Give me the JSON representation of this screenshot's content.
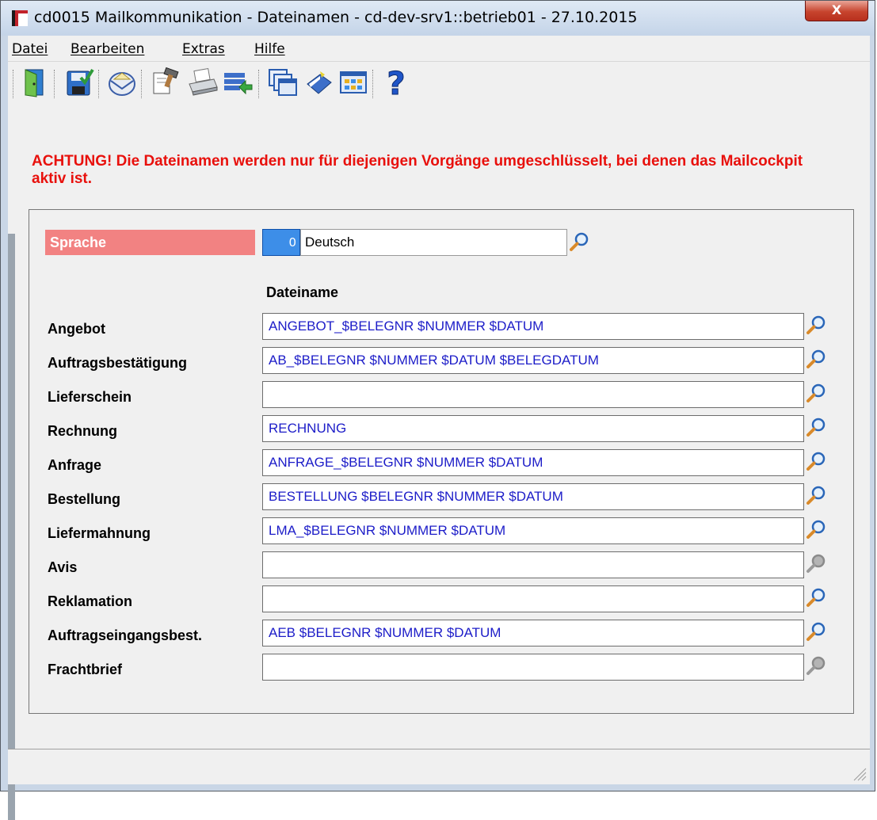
{
  "window": {
    "title": "cd0015 Mailkommunikation - Dateinamen - cd-dev-srv1::betrieb01 - 27.10.2015",
    "close_label": "X"
  },
  "menu": [
    "Datei",
    "Bearbeiten",
    "Extras",
    "Hilfe"
  ],
  "toolbar": {
    "buttons": [
      "exit-door-icon",
      "save-icon",
      "mail-icon",
      "edit-document-icon",
      "print-icon",
      "import-list-icon",
      "windows-icon",
      "book-icon",
      "grid-icon",
      "help-icon"
    ]
  },
  "warning": "ACHTUNG! Die Dateinamen werden nur für diejenigen Vorgänge umgeschlüsselt, bei denen das Mailcockpit aktiv ist.",
  "language": {
    "label": "Sprache",
    "code": "0",
    "name": "Deutsch"
  },
  "table": {
    "column_header": "Dateiname",
    "rows": [
      {
        "label": "Angebot",
        "value": "ANGEBOT_$BELEGNR $NUMMER $DATUM",
        "lookup_enabled": true
      },
      {
        "label": "Auftragsbestätigung",
        "value": "AB_$BELEGNR $NUMMER $DATUM $BELEGDATUM",
        "lookup_enabled": true
      },
      {
        "label": "Lieferschein",
        "value": "",
        "lookup_enabled": true
      },
      {
        "label": "Rechnung",
        "value": "RECHNUNG",
        "lookup_enabled": true
      },
      {
        "label": "Anfrage",
        "value": "ANFRAGE_$BELEGNR $NUMMER $DATUM",
        "lookup_enabled": true
      },
      {
        "label": "Bestellung",
        "value": "BESTELLUNG $BELEGNR $NUMMER $DATUM",
        "lookup_enabled": true
      },
      {
        "label": "Liefermahnung",
        "value": "LMA_$BELEGNR $NUMMER $DATUM",
        "lookup_enabled": true
      },
      {
        "label": "Avis",
        "value": "",
        "lookup_enabled": false
      },
      {
        "label": "Reklamation",
        "value": "",
        "lookup_enabled": true
      },
      {
        "label": "Auftragseingangsbest.",
        "value": "AEB $BELEGNR $NUMMER $DATUM",
        "lookup_enabled": true
      },
      {
        "label": "Frachtbrief",
        "value": "",
        "lookup_enabled": false
      }
    ]
  },
  "colors": {
    "warning": "#e8100c",
    "language_label_bg": "#f28282",
    "code_bg": "#3d8ee8",
    "field_text": "#1c1cc8"
  }
}
